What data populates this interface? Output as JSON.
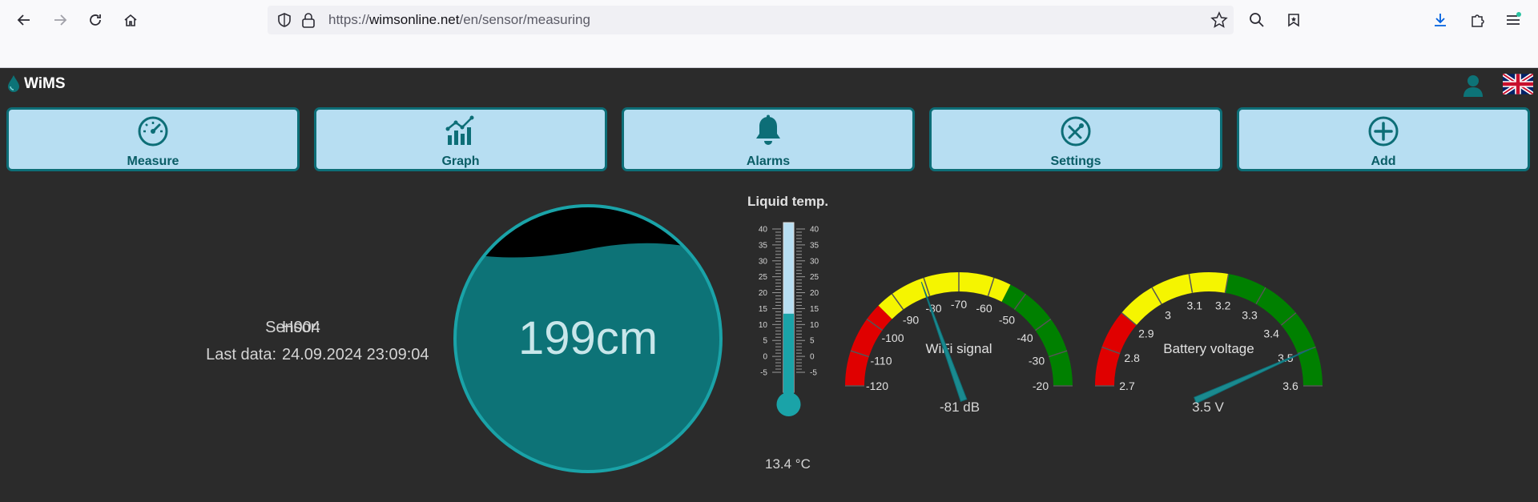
{
  "browser": {
    "url_prefix": "https://",
    "url_host": "wimsonline.net",
    "url_path": "/en/sensor/measuring"
  },
  "app": {
    "brand": "WiMS",
    "nav": [
      {
        "label": "Measure",
        "icon": "speedometer-icon"
      },
      {
        "label": "Graph",
        "icon": "bar-chart-icon"
      },
      {
        "label": "Alarms",
        "icon": "bell-icon"
      },
      {
        "label": "Settings",
        "icon": "tools-icon"
      },
      {
        "label": "Add",
        "icon": "plus-circle-icon"
      }
    ]
  },
  "sensor": {
    "sensor_label": "Sensor:",
    "sensor_value": "H004",
    "last_data_label": "Last data:",
    "last_data_value": "24.09.2024 23:09:04"
  },
  "tank": {
    "level_text": "199cm",
    "fill_fraction": 0.83,
    "color": "#0d7377"
  },
  "thermometer": {
    "title": "Liquid temp.",
    "value": 13.4,
    "value_text": "13.4 °C",
    "ticks": [
      "40",
      "35",
      "30",
      "25",
      "20",
      "15",
      "10",
      "5",
      "0",
      "-5"
    ],
    "min": -5,
    "max": 40
  },
  "wifi_gauge": {
    "label": "WiFi signal",
    "value": -81,
    "value_text": "-81 dB",
    "min": -120,
    "max": -20,
    "ticks": [
      "-120",
      "-110",
      "-100",
      "-90",
      "-80",
      "-70",
      "-60",
      "-50",
      "-40",
      "-30",
      "-20"
    ],
    "bands": [
      {
        "from": -120,
        "to": -95,
        "color": "#e00000"
      },
      {
        "from": -95,
        "to": -55,
        "color": "#f5f500"
      },
      {
        "from": -55,
        "to": -20,
        "color": "#008000"
      }
    ]
  },
  "battery_gauge": {
    "label": "Battery voltage",
    "value": 3.5,
    "value_text": "3.5 V",
    "min": 2.7,
    "max": 3.6,
    "ticks": [
      "2.7",
      "2.8",
      "2.9",
      "3",
      "3.1",
      "3.2",
      "3.3",
      "3.4",
      "3.5",
      "3.6"
    ],
    "bands": [
      {
        "from": 2.7,
        "to": 2.9,
        "color": "#e00000"
      },
      {
        "from": 2.9,
        "to": 3.2,
        "color": "#f5f500"
      },
      {
        "from": 3.2,
        "to": 3.6,
        "color": "#008000"
      }
    ]
  },
  "colors": {
    "accent": "#0d6e77",
    "tile_bg": "#b7def2",
    "needle": "#1a8a8f"
  }
}
